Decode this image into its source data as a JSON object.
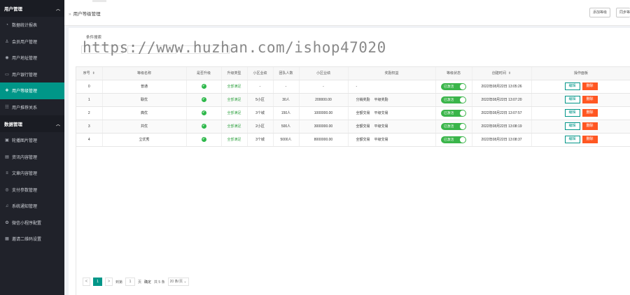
{
  "sidebar": {
    "groups": [
      {
        "title": "用户管理",
        "items": [
          {
            "label": "数据统计报表",
            "icon": "chart-icon"
          },
          {
            "label": "会员用户管理",
            "icon": "user-icon"
          },
          {
            "label": "用户地址管理",
            "icon": "location-icon"
          },
          {
            "label": "用户银行管理",
            "icon": "card-icon"
          },
          {
            "label": "用户等级管理",
            "icon": "level-icon",
            "active": true
          },
          {
            "label": "用户推荐关系",
            "icon": "relation-icon"
          }
        ]
      },
      {
        "title": "数据管理",
        "items": [
          {
            "label": "轮播图片管理",
            "icon": "image-icon"
          },
          {
            "label": "资讯内容管理",
            "icon": "news-icon"
          },
          {
            "label": "文章内容管理",
            "icon": "article-icon"
          },
          {
            "label": "支付参数管理",
            "icon": "pay-icon"
          },
          {
            "label": "系统通知管理",
            "icon": "bell-icon"
          },
          {
            "label": "微信小程序配置",
            "icon": "wechat-icon"
          },
          {
            "label": "邀请二维码设置",
            "icon": "qrcode-icon"
          }
        ]
      }
    ]
  },
  "header": {
    "breadcrumb": "用户等级管理",
    "add_button": "添加等级",
    "sync_button": "同步等"
  },
  "search": {
    "title": "条件搜索"
  },
  "watermark": "https://www.huzhan.com/ishop47020",
  "table": {
    "columns": [
      "序号",
      "等级名称",
      "是否升级",
      "升级类型",
      "小区业绩",
      "团队人数",
      "小区业绩",
      "奖励权益",
      "等级状态",
      "创建时间",
      "操作面板"
    ],
    "rows": [
      {
        "id": "0",
        "name": "普通",
        "type": "全部满足",
        "perf": "-",
        "team": "-",
        "amount": "-",
        "rights": [
          "-"
        ],
        "status": "已激活",
        "time": "2022年08月22日 13:05:26"
      },
      {
        "id": "1",
        "name": "联优",
        "type": "全部满足",
        "perf": "5小区",
        "team": "30人",
        "amount": "200000.00",
        "rights": [
          "分销奖励",
          "平级奖励"
        ],
        "status": "已激活",
        "time": "2022年08月22日 13:07:20"
      },
      {
        "id": "2",
        "name": "典优",
        "type": "全部满足",
        "perf": "3个城",
        "team": "150人",
        "amount": "1000000.00",
        "rights": [
          "全额交易",
          "平级交易"
        ],
        "status": "已激活",
        "time": "2022年08月22日 13:07:57"
      },
      {
        "id": "3",
        "name": "共优",
        "type": "全部满足",
        "perf": "2小区",
        "team": "500人",
        "amount": "3000000.00",
        "rights": [
          "全额交易",
          "平级交易"
        ],
        "status": "已激活",
        "time": "2022年08月22日 13:08:19"
      },
      {
        "id": "4",
        "name": "立优秀",
        "type": "全部满足",
        "perf": "3个城",
        "team": "5000人",
        "amount": "8000000.00",
        "rights": [
          "全额交易",
          "平级交易"
        ],
        "status": "已激活",
        "time": "2022年08月22日 13:08:37"
      }
    ],
    "edit_label": "编辑",
    "delete_label": "删除"
  },
  "pager": {
    "prev": "<",
    "current": "1",
    "next": ">",
    "goto_label": "到第",
    "goto_value": "1",
    "page_unit": "页",
    "confirm": "确定",
    "total": "共 5 条",
    "per_page": "20 条/页"
  },
  "colors": {
    "sidebar": "#20222a",
    "accent": "#009688",
    "delete": "#ff5722",
    "success": "#3ab54a"
  }
}
